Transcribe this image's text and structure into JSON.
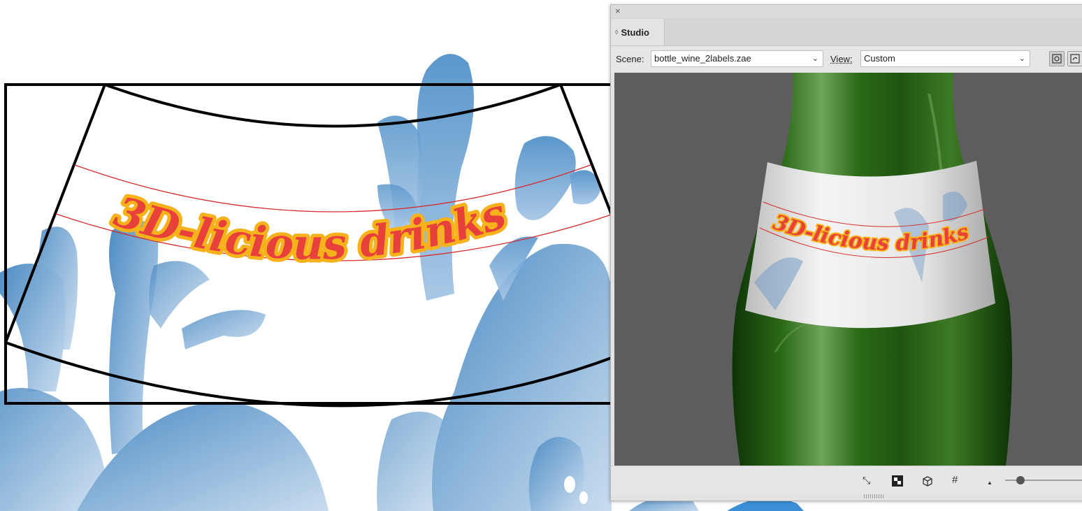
{
  "artwork": {
    "label_text": "3D-licious drinks",
    "colors": {
      "text_fill": "#e8403a",
      "text_outline": "#f6b21b",
      "splash": "#5d98c9",
      "guide_line": "#d62b2b",
      "frame": "#000000"
    }
  },
  "studio_panel": {
    "close_icon": "×",
    "tab": {
      "collapse_icon": "◊",
      "label": "Studio"
    },
    "scene": {
      "label": "Scene:",
      "value": "bottle_wine_2labels.zae"
    },
    "view": {
      "label": "View:",
      "value": "Custom"
    },
    "viewport": {
      "label_text": "3D-licious drinks",
      "colors": {
        "background": "#5d5d5d",
        "glass": "#1f5c10",
        "label_paper": "#f0f0f0"
      }
    },
    "bottom_toolbar": {
      "icons": [
        "fit-view-icon",
        "checker-icon",
        "cube-icon",
        "grid-icon",
        "light-icon"
      ],
      "glyphs": {
        "fit": "⤡",
        "grid": "#",
        "light": "▲"
      },
      "zoom_level": 0.2
    }
  }
}
